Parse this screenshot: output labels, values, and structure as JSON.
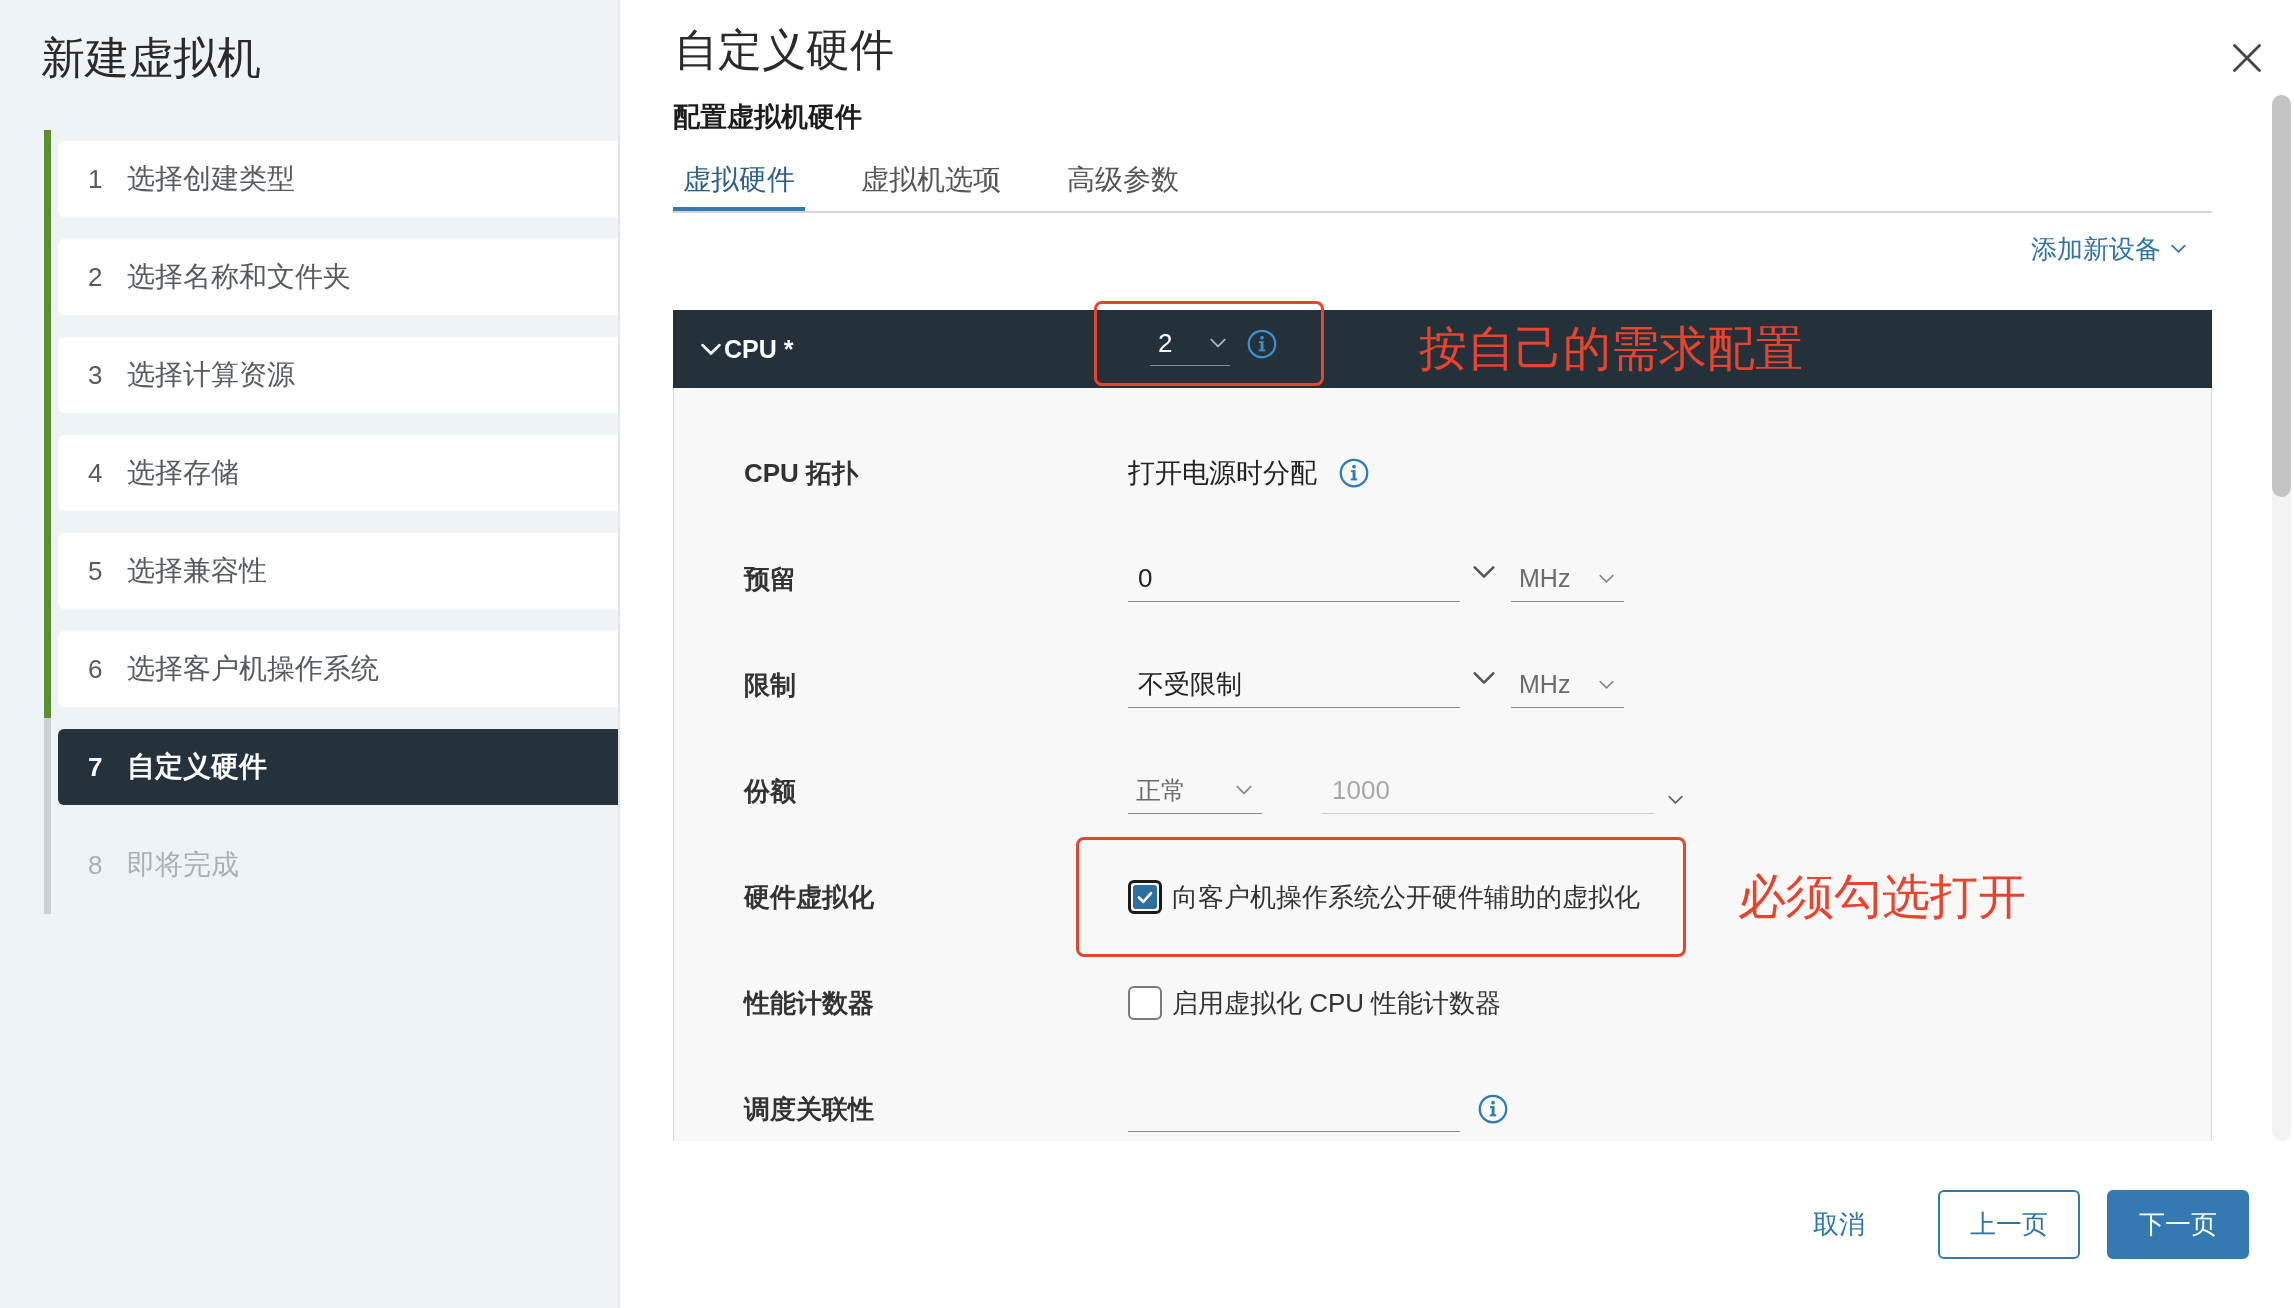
{
  "sidebar": {
    "title": "新建虚拟机",
    "steps": [
      {
        "number": "1",
        "label": "选择创建类型",
        "completed": true,
        "selected": false,
        "disabled": false
      },
      {
        "number": "2",
        "label": "选择名称和文件夹",
        "completed": true,
        "selected": false,
        "disabled": false
      },
      {
        "number": "3",
        "label": "选择计算资源",
        "completed": true,
        "selected": false,
        "disabled": false
      },
      {
        "number": "4",
        "label": "选择存储",
        "completed": true,
        "selected": false,
        "disabled": false
      },
      {
        "number": "5",
        "label": "选择兼容性",
        "completed": true,
        "selected": false,
        "disabled": false
      },
      {
        "number": "6",
        "label": "选择客户机操作系统",
        "completed": true,
        "selected": false,
        "disabled": false
      },
      {
        "number": "7",
        "label": "自定义硬件",
        "completed": false,
        "selected": true,
        "disabled": false
      },
      {
        "number": "8",
        "label": "即将完成",
        "completed": false,
        "selected": false,
        "disabled": true
      }
    ]
  },
  "dialog": {
    "title": "自定义硬件",
    "subtitle": "配置虚拟机硬件",
    "tabs": [
      {
        "label": "虚拟硬件",
        "selected": true
      },
      {
        "label": "虚拟机选项",
        "selected": false
      },
      {
        "label": "高级参数",
        "selected": false
      }
    ],
    "add_device": {
      "label": "添加新设备"
    },
    "cpu_panel": {
      "title": "CPU *",
      "expanded": true,
      "cpu_count": "2",
      "annotation": "按自己的需求配置",
      "rows": [
        {
          "kind": "text",
          "label": "CPU 拓扑",
          "value": "打开电源时分配",
          "info": true
        },
        {
          "kind": "combo",
          "label": "预留",
          "value": "0",
          "unit": "MHz"
        },
        {
          "kind": "combo",
          "label": "限制",
          "value": "不受限制",
          "unit": "MHz"
        },
        {
          "kind": "shares",
          "label": "份额",
          "level_select": "正常",
          "value": "1000",
          "disabled": true
        },
        {
          "kind": "checkbox",
          "label": "硬件虚拟化",
          "option": "向客户机操作系统公开硬件辅助的虚拟化",
          "checked": true,
          "annotation": "必须勾选打开"
        },
        {
          "kind": "checkbox",
          "label": "性能计数器",
          "option": "启用虚拟化 CPU 性能计数器",
          "checked": false
        },
        {
          "kind": "input",
          "label": "调度关联性",
          "info": true
        }
      ]
    },
    "buttons": [
      {
        "label": "取消",
        "kind": "link"
      },
      {
        "label": "上一页",
        "kind": "secondary"
      },
      {
        "label": "下一页",
        "kind": "primary"
      }
    ]
  }
}
